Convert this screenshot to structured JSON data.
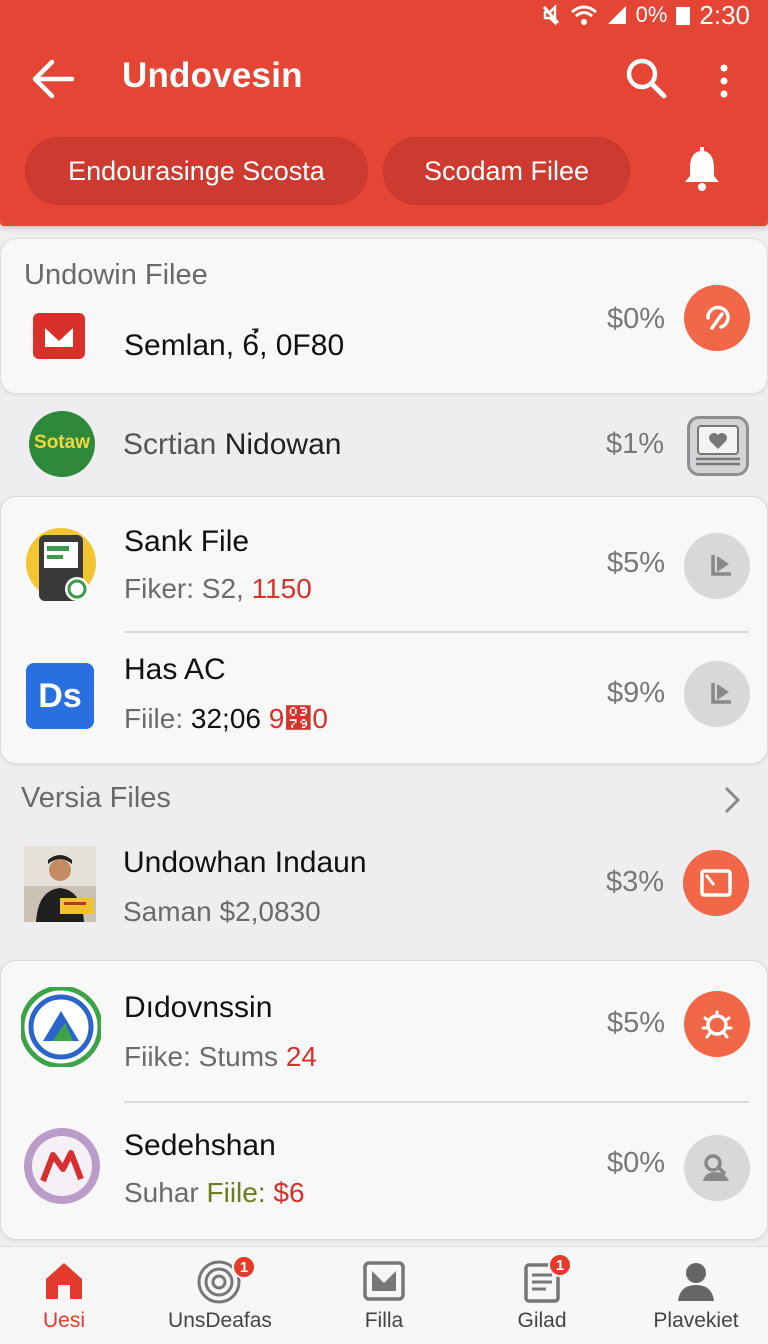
{
  "status_bar": {
    "battery": "0%",
    "time": "2:30"
  },
  "header": {
    "title": "Undovesin",
    "chips": [
      "Endourasinge Scosta",
      "Scodam Filee"
    ]
  },
  "top_card": {
    "section_label": "Undowin Filee",
    "item": {
      "title": "Semlan, 6́̉, 0F80",
      "pct": "$0%"
    }
  },
  "plain_row": {
    "icon_text": "Sotaw",
    "title_light": "Scrtian ",
    "title_dark": "Nidowan",
    "pct": "$1%"
  },
  "middle_card": {
    "items": [
      {
        "title": "Sank File",
        "sub_prefix": "Fiker: S2, ",
        "sub_accent": "1150",
        "pct": "$5%"
      },
      {
        "title": "Has AC",
        "icon_text": "Ds",
        "sub_prefix": "Fiile: ",
        "sub_dark": "32;06 ",
        "sub_accent": "9͹0",
        "pct": "$9%"
      }
    ]
  },
  "versia": {
    "section_label": "Versia Files",
    "item": {
      "title": "Undowhan Indaun",
      "sub": "Saman $2,0830",
      "pct": "$3%"
    }
  },
  "bottom_card": {
    "items": [
      {
        "title": "Dıdovnssin",
        "sub_prefix": "Fiike: Stums ",
        "sub_accent": "24",
        "pct": "$5%"
      },
      {
        "title": "Sedehshan",
        "sub_prefix": "Suhar ",
        "sub_green": "Fiile: ",
        "sub_accent": "$6",
        "pct": "$0%"
      }
    ]
  },
  "bottom_nav": {
    "items": [
      {
        "label": "Uesi",
        "active": true
      },
      {
        "label": "UnsDeafas",
        "badge": "1"
      },
      {
        "label": "Filla"
      },
      {
        "label": "Gilad",
        "badge": "1"
      },
      {
        "label": "Plavekiet"
      }
    ]
  },
  "colors": {
    "header": "#e54535",
    "chip": "#cc3a30",
    "accent_orange": "#f26747",
    "accent_red": "#d2332b"
  }
}
